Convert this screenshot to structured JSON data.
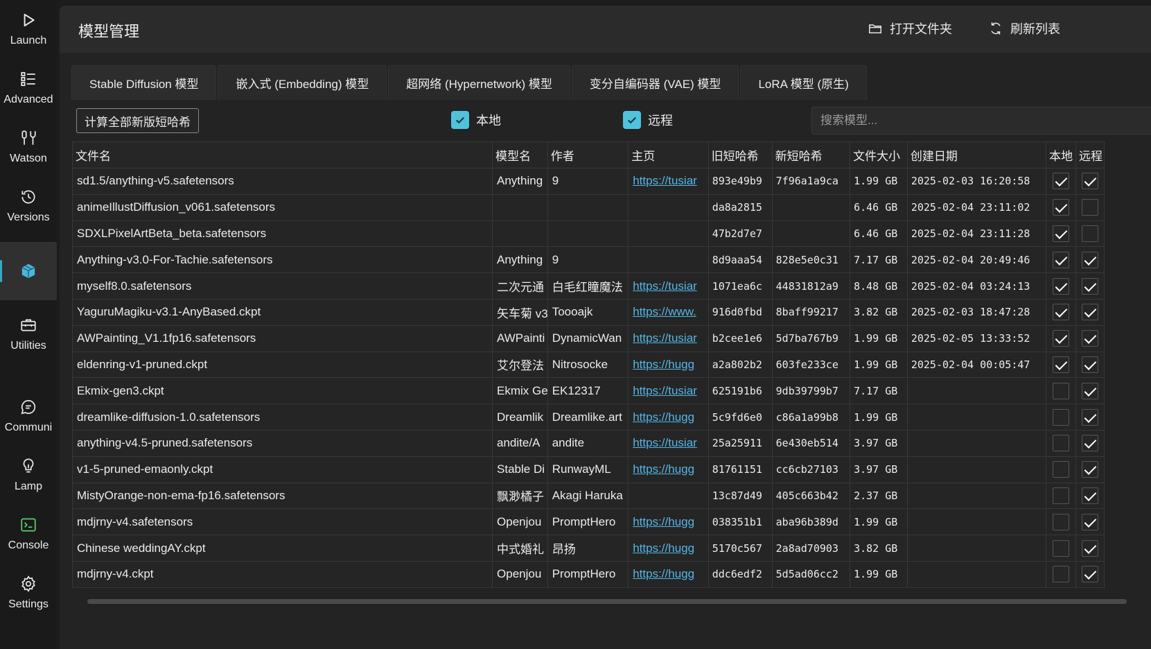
{
  "sidebar": {
    "items": [
      {
        "label": "Launch",
        "icon": "play-icon"
      },
      {
        "label": "Advanced",
        "icon": "list-icon"
      },
      {
        "label": "Watson",
        "icon": "tools-icon"
      },
      {
        "label": "Versions",
        "icon": "history-icon"
      },
      {
        "label": "",
        "icon": "cube-icon"
      },
      {
        "label": "Utilities",
        "icon": "toolbox-icon"
      },
      {
        "label": "Communi",
        "icon": "chat-icon"
      },
      {
        "label": "Lamp",
        "icon": "bulb-icon"
      },
      {
        "label": "Console",
        "icon": "terminal-icon"
      },
      {
        "label": "Settings",
        "icon": "gear-icon"
      }
    ]
  },
  "header": {
    "title": "模型管理",
    "open_folder": "打开文件夹",
    "refresh": "刷新列表"
  },
  "tabs": [
    "Stable Diffusion 模型",
    "嵌入式 (Embedding) 模型",
    "超网络 (Hypernetwork) 模型",
    "变分自编码器 (VAE) 模型",
    "LoRA 模型 (原生)"
  ],
  "toolbar": {
    "calc_button": "计算全部新版短哈希",
    "filter_local": "本地",
    "filter_remote": "远程",
    "search_placeholder": "搜索模型..."
  },
  "table": {
    "columns": [
      "文件名",
      "模型名",
      "作者",
      "主页",
      "旧短哈希",
      "新短哈希",
      "文件大小",
      "创建日期",
      "本地",
      "远程"
    ],
    "rows": [
      {
        "file": "sd1.5/anything-v5.safetensors",
        "model": "Anything",
        "author": "9",
        "home": "https://tusiar",
        "old": "893e49b9",
        "new": "7f96a1a9ca",
        "size": "1.99 GB",
        "date": "2025-02-03 16:20:58",
        "local": true,
        "remote": true
      },
      {
        "file": "animeIllustDiffusion_v061.safetensors",
        "model": "",
        "author": "",
        "home": "",
        "old": "da8a2815",
        "new": "",
        "size": "6.46 GB",
        "date": "2025-02-04 23:11:02",
        "local": true,
        "remote": false
      },
      {
        "file": "SDXLPixelArtBeta_beta.safetensors",
        "model": "",
        "author": "",
        "home": "",
        "old": "47b2d7e7",
        "new": "",
        "size": "6.46 GB",
        "date": "2025-02-04 23:11:28",
        "local": true,
        "remote": false
      },
      {
        "file": "Anything-v3.0-For-Tachie.safetensors",
        "model": "Anything",
        "author": "9",
        "home": "",
        "old": "8d9aaa54",
        "new": "828e5e0c31",
        "size": "7.17 GB",
        "date": "2025-02-04 20:49:46",
        "local": true,
        "remote": true
      },
      {
        "file": "myself8.0.safetensors",
        "model": "二次元通",
        "author": "白毛红瞳魔法",
        "home": "https://tusiar",
        "old": "1071ea6c",
        "new": "44831812a9",
        "size": "8.48 GB",
        "date": "2025-02-04 03:24:13",
        "local": true,
        "remote": true
      },
      {
        "file": "YaguruMagiku-v3.1-AnyBased.ckpt",
        "model": "矢车菊 v3",
        "author": "Toooajk",
        "home": "https://www.",
        "old": "916d0fbd",
        "new": "8baff99217",
        "size": "3.82 GB",
        "date": "2025-02-03 18:47:28",
        "local": true,
        "remote": true
      },
      {
        "file": "AWPainting_V1.1fp16.safetensors",
        "model": "AWPainti",
        "author": "DynamicWan",
        "home": "https://tusiar",
        "old": "b2cee1e6",
        "new": "5d7ba767b9",
        "size": "1.99 GB",
        "date": "2025-02-05 13:33:52",
        "local": true,
        "remote": true
      },
      {
        "file": "eldenring-v1-pruned.ckpt",
        "model": "艾尔登法",
        "author": "Nitrosocke",
        "home": "https://hugg",
        "old": "a2a802b2",
        "new": "603fe233ce",
        "size": "1.99 GB",
        "date": "2025-02-04 00:05:47",
        "local": true,
        "remote": true
      },
      {
        "file": "Ekmix-gen3.ckpt",
        "model": "Ekmix Ge",
        "author": "EK12317",
        "home": "https://tusiar",
        "old": "625191b6",
        "new": "9db39799b7",
        "size": "7.17 GB",
        "date": "",
        "local": false,
        "remote": true
      },
      {
        "file": "dreamlike-diffusion-1.0.safetensors",
        "model": "Dreamlik",
        "author": "Dreamlike.art",
        "home": "https://hugg",
        "old": "5c9fd6e0",
        "new": "c86a1a99b8",
        "size": "1.99 GB",
        "date": "",
        "local": false,
        "remote": true
      },
      {
        "file": "anything-v4.5-pruned.safetensors",
        "model": "andite/A",
        "author": "andite",
        "home": "https://tusiar",
        "old": "25a25911",
        "new": "6e430eb514",
        "size": "3.97 GB",
        "date": "",
        "local": false,
        "remote": true
      },
      {
        "file": "v1-5-pruned-emaonly.ckpt",
        "model": "Stable Di",
        "author": "RunwayML",
        "home": "https://hugg",
        "old": "81761151",
        "new": "cc6cb27103",
        "size": "3.97 GB",
        "date": "",
        "local": false,
        "remote": true
      },
      {
        "file": "MistyOrange-non-ema-fp16.safetensors",
        "model": "飘渺橘子",
        "author": "Akagi Haruka",
        "home": "",
        "old": "13c87d49",
        "new": "405c663b42",
        "size": "2.37 GB",
        "date": "",
        "local": false,
        "remote": true
      },
      {
        "file": "mdjrny-v4.safetensors",
        "model": "Openjou",
        "author": "PromptHero",
        "home": "https://hugg",
        "old": "038351b1",
        "new": "aba96b389d",
        "size": "1.99 GB",
        "date": "",
        "local": false,
        "remote": true
      },
      {
        "file": "Chinese weddingAY.ckpt",
        "model": "中式婚礼",
        "author": "昂扬",
        "home": "https://hugg",
        "old": "5170c567",
        "new": "2a8ad70903",
        "size": "3.82 GB",
        "date": "",
        "local": false,
        "remote": true
      },
      {
        "file": "mdjrny-v4.ckpt",
        "model": "Openjou",
        "author": "PromptHero",
        "home": "https://hugg",
        "old": "ddc6edf2",
        "new": "5d5ad06cc2",
        "size": "1.99 GB",
        "date": "",
        "local": false,
        "remote": true
      }
    ]
  }
}
